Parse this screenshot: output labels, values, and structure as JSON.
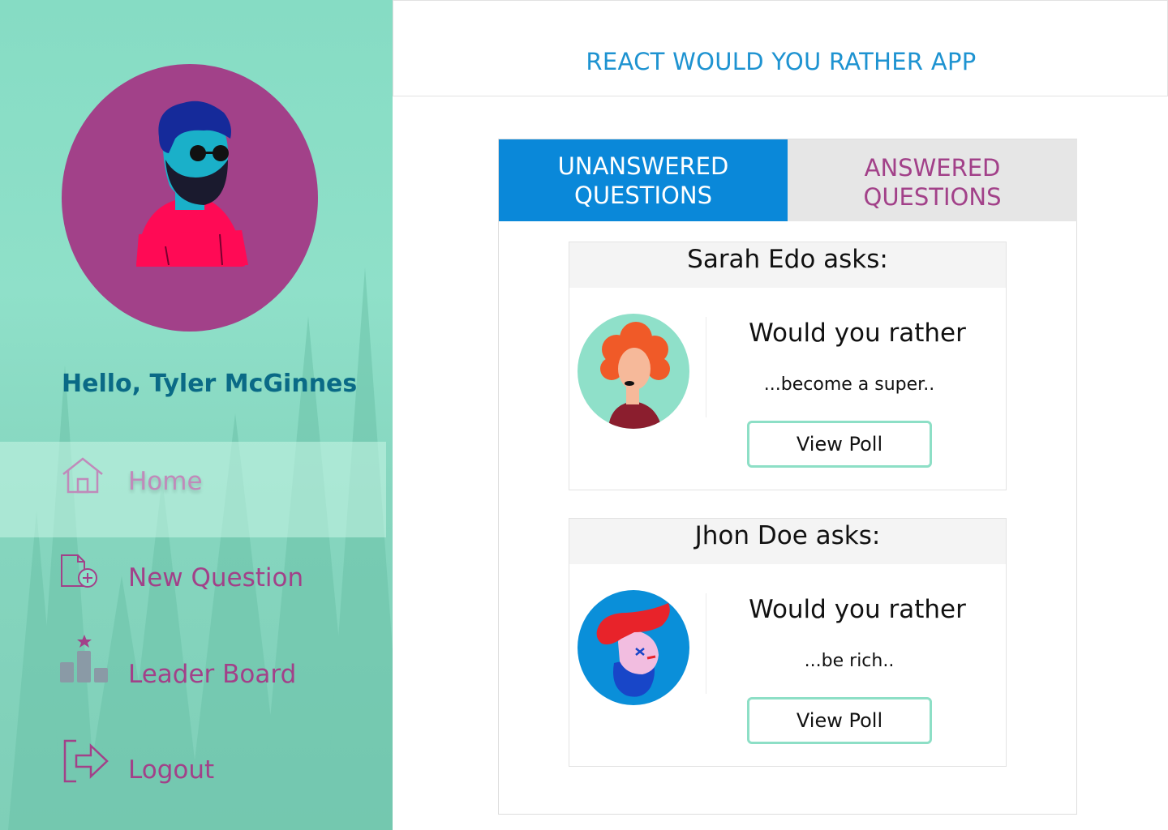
{
  "app": {
    "title": "REACT WOULD YOU RATHER APP"
  },
  "user": {
    "greeting": "Hello, Tyler McGinnes"
  },
  "sidebar": {
    "items": [
      {
        "label": "Home",
        "icon": "home-icon",
        "active": true
      },
      {
        "label": "New Question",
        "icon": "new-question-icon",
        "active": false
      },
      {
        "label": "Leader Board",
        "icon": "leaderboard-icon",
        "active": false
      },
      {
        "label": "Logout",
        "icon": "logout-icon",
        "active": false
      }
    ]
  },
  "tabs": [
    {
      "label": "UNANSWERED\nQUESTIONS",
      "active": true
    },
    {
      "label": "ANSWERED\nQUESTIONS",
      "active": false
    }
  ],
  "questions": [
    {
      "author_line": "Sarah Edo asks:",
      "prompt": "Would you rather",
      "option_preview": "...become a super..",
      "button_label": "View Poll"
    },
    {
      "author_line": "Jhon Doe asks:",
      "prompt": "Would you rather",
      "option_preview": "...be rich..",
      "button_label": "View Poll"
    }
  ],
  "colors": {
    "sidebar_bg": "#8fe0c9",
    "accent_purple": "#a24189",
    "accent_blue": "#0a88d9",
    "title_blue": "#1e93d1",
    "button_border": "#8ddfc6"
  }
}
